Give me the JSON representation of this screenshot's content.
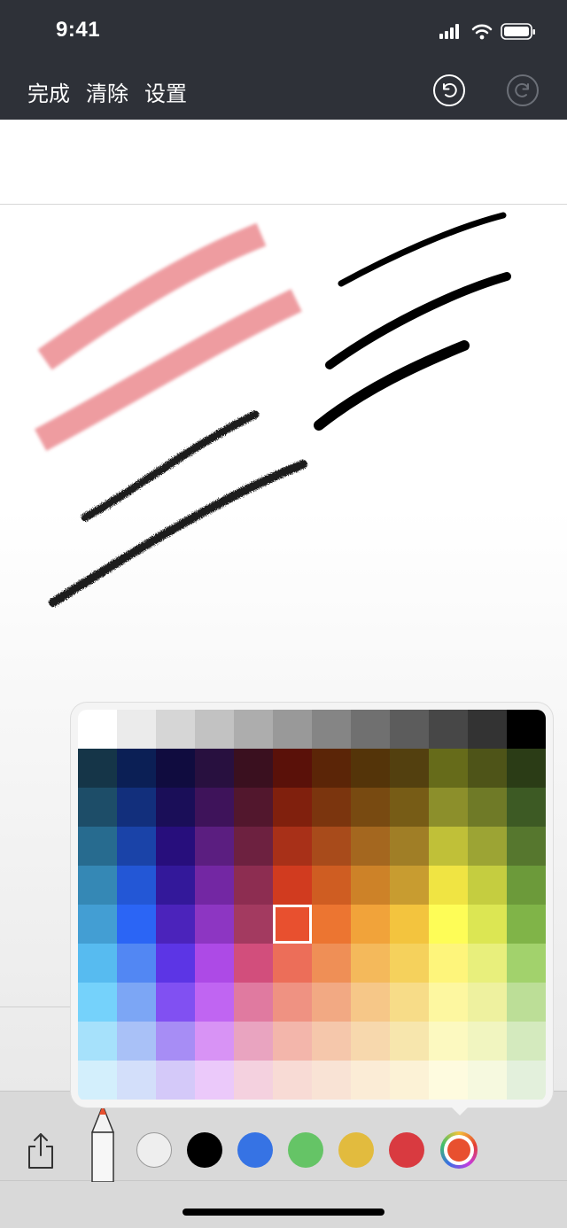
{
  "status_bar": {
    "time": "9:41"
  },
  "nav": {
    "done": "完成",
    "clear": "清除",
    "settings": "设置"
  },
  "icons": {
    "undo": "undo-icon",
    "redo": "redo-icon",
    "share": "share-icon",
    "pencil": "pencil-icon"
  },
  "palette": {
    "grayscale": [
      "#ffffff",
      "#ebebeb",
      "#d6d6d6",
      "#c2c2c2",
      "#adadad",
      "#999999",
      "#858585",
      "#707070",
      "#5c5c5c",
      "#474747",
      "#333333",
      "#000000"
    ],
    "rows": [
      [
        "#153548",
        "#0b1f55",
        "#100c3f",
        "#28103f",
        "#3a101f",
        "#5a1109",
        "#5b2507",
        "#543409",
        "#53400f",
        "#666b1a",
        "#4e5418",
        "#2b3c16"
      ],
      [
        "#1d4d68",
        "#122f7c",
        "#1a0e58",
        "#3e135a",
        "#52172d",
        "#80200d",
        "#7b350e",
        "#784a11",
        "#775c16",
        "#8c8f2b",
        "#6f7a27",
        "#3d5a24"
      ],
      [
        "#276b8f",
        "#1a43a8",
        "#270e7c",
        "#5b1e80",
        "#6d2140",
        "#a83018",
        "#a84b1b",
        "#a4671f",
        "#a07e26",
        "#c0c038",
        "#9ca434",
        "#56772e"
      ],
      [
        "#3588b5",
        "#2357d6",
        "#33189a",
        "#7327a3",
        "#8d2d51",
        "#d13b1f",
        "#cf5d22",
        "#cd8228",
        "#c89c30",
        "#f0e443",
        "#c5cd40",
        "#6c9a3a"
      ],
      [
        "#439ed3",
        "#2b65f5",
        "#4b23bb",
        "#8d36c2",
        "#a33a60",
        "#e8502f",
        "#ec7531",
        "#f1a33a",
        "#f3c43e",
        "#fefd57",
        "#dce653",
        "#80b448"
      ],
      [
        "#57bbf0",
        "#5287f3",
        "#5c35e5",
        "#ad4ae6",
        "#d24e7c",
        "#ec6e59",
        "#ef8f56",
        "#f4b95b",
        "#f5d15c",
        "#fef57b",
        "#e8ef7c",
        "#a2d26c"
      ],
      [
        "#75d2fb",
        "#7ca6f5",
        "#8150f2",
        "#c065f2",
        "#e07aa0",
        "#ef9282",
        "#f2a983",
        "#f6c788",
        "#f7dc88",
        "#fdf7a0",
        "#eef19f",
        "#bcde97"
      ],
      [
        "#a6e1fb",
        "#a9c1f7",
        "#a78df5",
        "#d893f5",
        "#e9a4c0",
        "#f3b6ab",
        "#f5c7ab",
        "#f7d8ad",
        "#f7e6ad",
        "#fcf9c0",
        "#f1f5c0",
        "#d4eabe"
      ],
      [
        "#d3effc",
        "#d3dffa",
        "#d4c9f9",
        "#ebc9fa",
        "#f4d1df",
        "#f8dbd5",
        "#f9e3d5",
        "#fbecd6",
        "#fcf2d6",
        "#fefbdf",
        "#f6f9df",
        "#e3f0dc"
      ]
    ],
    "selected": {
      "row": 4,
      "col": 5,
      "color": "#e8502f"
    }
  },
  "toolbar": {
    "pencil_tip_color": "#e8502f",
    "swatches": [
      {
        "name": "white",
        "color": "#eeeeee"
      },
      {
        "name": "black",
        "color": "#000000"
      },
      {
        "name": "blue",
        "color": "#3673e4"
      },
      {
        "name": "green",
        "color": "#65c466"
      },
      {
        "name": "yellow",
        "color": "#e2bb3e"
      },
      {
        "name": "red",
        "color": "#d93a40"
      }
    ],
    "custom_color": "#e8502f"
  }
}
